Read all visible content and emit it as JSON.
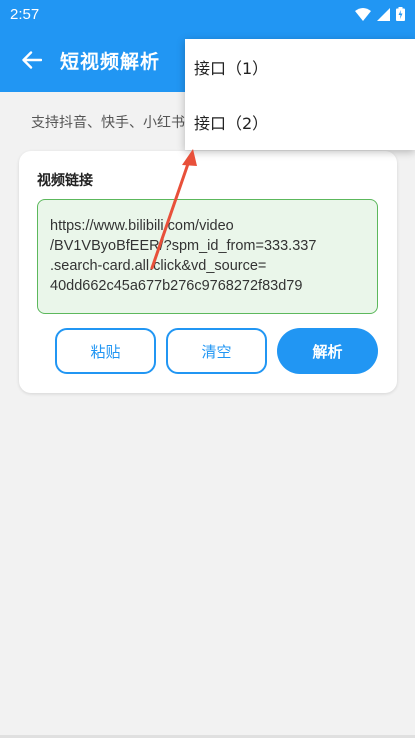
{
  "status_bar": {
    "time": "2:57",
    "icons": [
      "wifi-icon",
      "signal-icon",
      "battery-charging-icon"
    ]
  },
  "app_bar": {
    "title": "短视频解析",
    "back_icon": "arrow-left-icon"
  },
  "support_text": "支持抖音、快手、小红书",
  "card": {
    "title": "视频链接",
    "link_lines": [
      "https://www.bilibili.com/video",
      "/BV1VByoBfEER/?spm_id_from=333.337",
      ".search-card.all.click&vd_source=",
      "40dd662c45a677b276c9768272f83d79"
    ],
    "buttons": {
      "paste": "粘贴",
      "clear": "清空",
      "parse": "解析"
    }
  },
  "menu": {
    "items": [
      "接口（1）",
      "接口（2）"
    ]
  },
  "colors": {
    "primary": "#2196f3",
    "link_box_bg": "#eaf6ea",
    "link_box_border": "#5cb85c",
    "annotation_arrow": "#e8503a"
  }
}
